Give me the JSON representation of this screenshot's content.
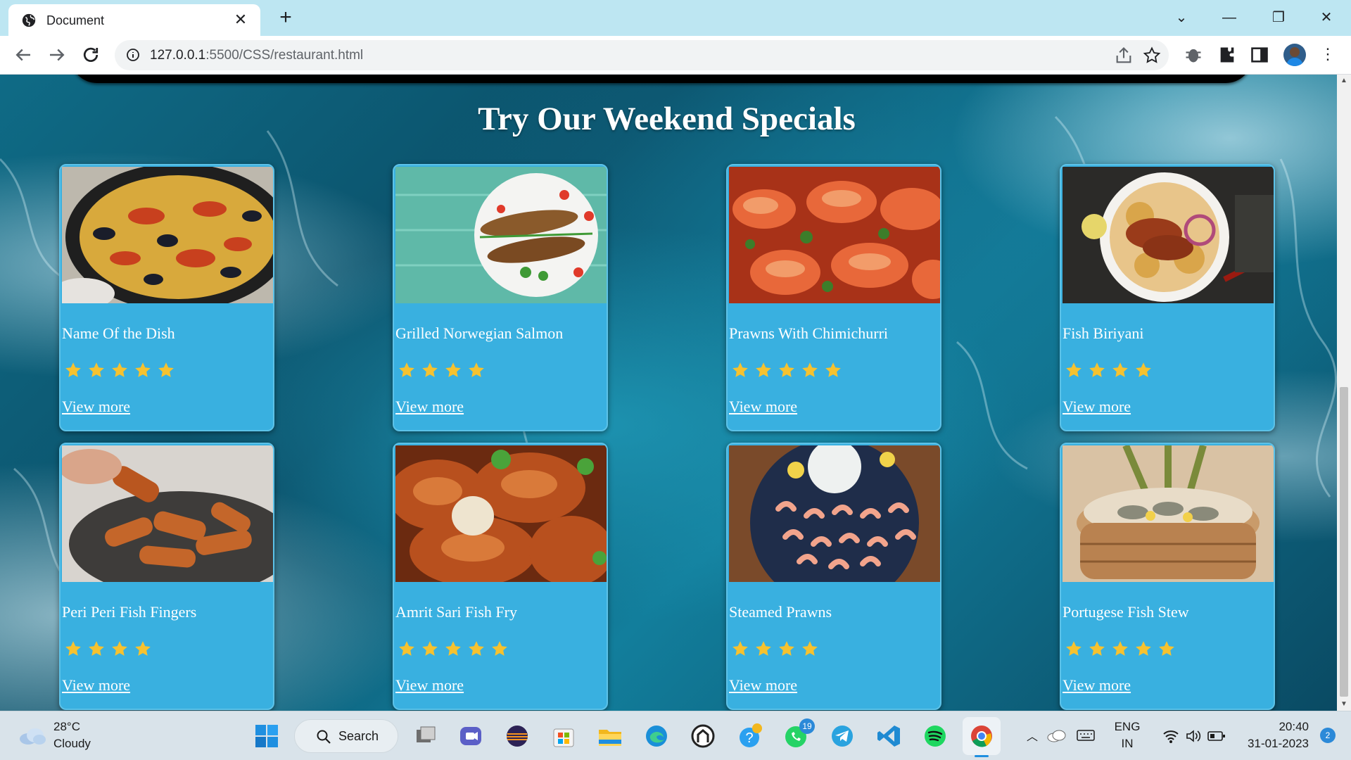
{
  "browser": {
    "tab_title": "Document",
    "url_host": "127.0.0.1",
    "url_path": ":5500/CSS/restaurant.html"
  },
  "page": {
    "heading": "Try Our Weekend Specials",
    "link_label": "View more",
    "dishes": [
      {
        "name": "Name Of the Dish",
        "stars": 5,
        "photo": "paella"
      },
      {
        "name": "Grilled Norwegian Salmon",
        "stars": 4,
        "photo": "grilled-fish"
      },
      {
        "name": "Prawns With Chimichurri",
        "stars": 5,
        "photo": "prawns"
      },
      {
        "name": "Fish Biriyani",
        "stars": 4,
        "photo": "biriyani"
      },
      {
        "name": "Peri Peri Fish Fingers",
        "stars": 4,
        "photo": "fish-fingers"
      },
      {
        "name": "Amrit Sari Fish Fry",
        "stars": 5,
        "photo": "fish-fry"
      },
      {
        "name": "Steamed Prawns",
        "stars": 4,
        "photo": "steamed-prawns"
      },
      {
        "name": "Portugese Fish Stew",
        "stars": 5,
        "photo": "fish-stew"
      }
    ]
  },
  "taskbar": {
    "temperature": "28°C",
    "condition": "Cloudy",
    "search_label": "Search",
    "whatsapp_badge": "19",
    "language": "ENG",
    "region": "IN",
    "time": "20:40",
    "date": "31-01-2023",
    "notifications": "2"
  },
  "colors": {
    "card": "#39b0e0",
    "star": "#f6c22f",
    "tabstrip": "#bde6f2"
  }
}
